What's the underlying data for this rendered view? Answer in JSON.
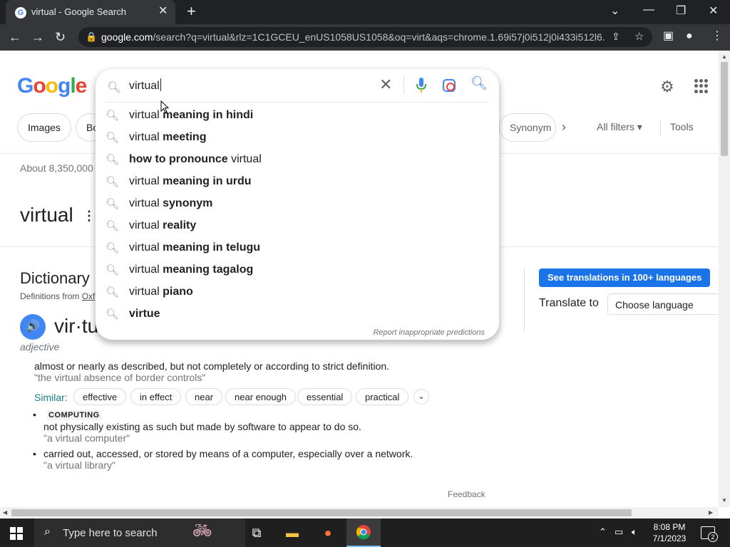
{
  "browser": {
    "tab_title": "virtual - Google Search",
    "url_domain": "google.com",
    "url_rest": "/search?q=virtual&rlz=1C1GCEU_enUS1058US1058&oq=virt&aqs=chrome.1.69i57j0i512j0i433i512l6..."
  },
  "google": {
    "logo_letters": [
      "G",
      "o",
      "o",
      "g",
      "l",
      "e"
    ],
    "logo_colors": [
      "#4285f4",
      "#ea4335",
      "#fbbc05",
      "#4285f4",
      "#34a853",
      "#ea4335"
    ],
    "chips": [
      "Images",
      "Bo",
      "Synonym"
    ],
    "all_filters": "All filters",
    "tools": "Tools",
    "stats": "About 8,350,000",
    "word": "virtual",
    "dictionary_heading": "Dictionary",
    "defs_from": "Definitions from",
    "defs_source": "Oxf",
    "headword": "vir·tu",
    "pos": "adjective",
    "def1": "almost or nearly as described, but not completely or according to strict definition.",
    "ex1": "\"the virtual absence of border controls\"",
    "similar_label": "Similar:",
    "similar": [
      "effective",
      "in effect",
      "near",
      "near enough",
      "essential",
      "practical"
    ],
    "computing_label": "COMPUTING",
    "def2": "not physically existing as such but made by software to appear to do so.",
    "ex2": "\"a virtual computer\"",
    "def3": "carried out, accessed, or stored by means of a computer, especially over a network.",
    "ex3": "\"a virtual library\"",
    "feedback": "Feedback",
    "translate_button": "See translations in 100+ languages",
    "translate_to": "Translate to",
    "choose_language": "Choose language"
  },
  "search": {
    "query": "virtual",
    "suggestions": [
      {
        "pre": "virtual ",
        "bold": "meaning in hindi",
        "post": ""
      },
      {
        "pre": "virtual ",
        "bold": "meeting",
        "post": ""
      },
      {
        "pre": "",
        "bold": "how to pronounce",
        "post": " virtual"
      },
      {
        "pre": "virtual ",
        "bold": "meaning in urdu",
        "post": ""
      },
      {
        "pre": "virtual ",
        "bold": "synonym",
        "post": ""
      },
      {
        "pre": "virtual ",
        "bold": "reality",
        "post": ""
      },
      {
        "pre": "virtual ",
        "bold": "meaning in telugu",
        "post": ""
      },
      {
        "pre": "virtual ",
        "bold": "meaning tagalog",
        "post": ""
      },
      {
        "pre": "virtual ",
        "bold": "piano",
        "post": ""
      },
      {
        "pre": "",
        "bold": "virtue",
        "post": ""
      }
    ],
    "report": "Report inappropriate predictions"
  },
  "taskbar": {
    "search_placeholder": "Type here to search",
    "time": "8:08 PM",
    "date": "7/1/2023",
    "notifications": "2"
  }
}
